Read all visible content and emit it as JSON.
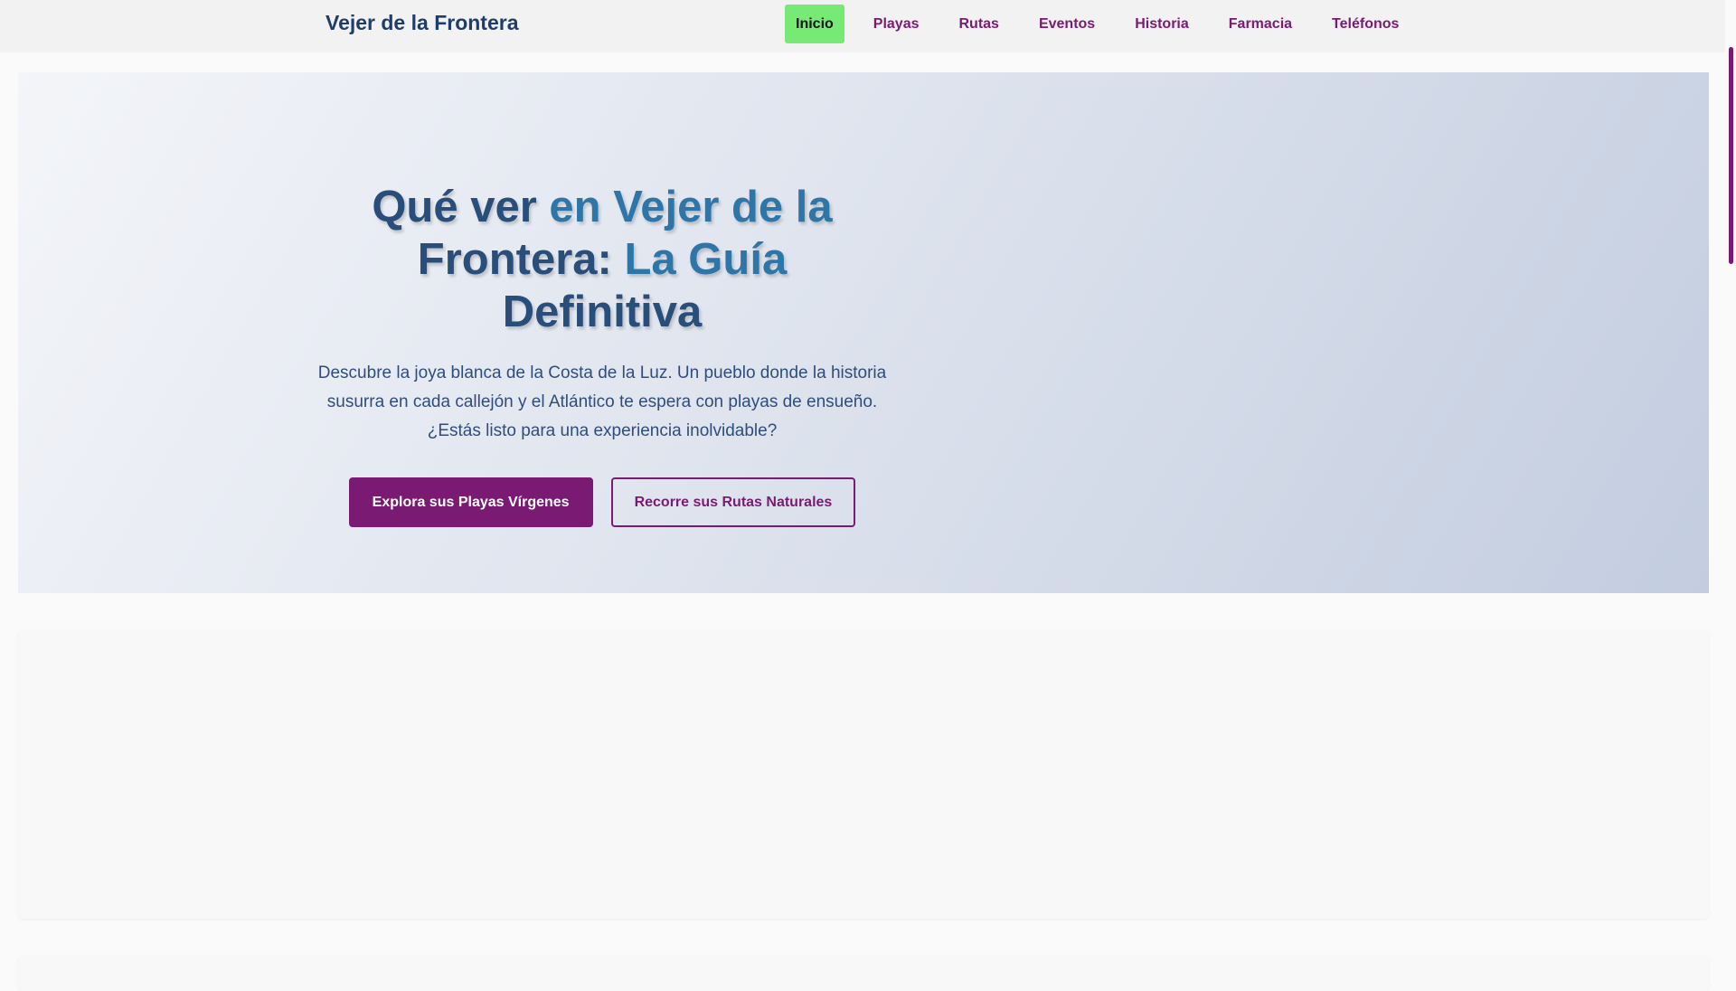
{
  "header": {
    "brand": "Vejer de la Frontera",
    "nav": [
      {
        "label": "Inicio",
        "active": true
      },
      {
        "label": "Playas",
        "active": false
      },
      {
        "label": "Rutas",
        "active": false
      },
      {
        "label": "Eventos",
        "active": false
      },
      {
        "label": "Historia",
        "active": false
      },
      {
        "label": "Farmacia",
        "active": false
      },
      {
        "label": "Teléfonos",
        "active": false
      }
    ]
  },
  "hero": {
    "title_part1": "Qué ver ",
    "title_part2": "en Vejer de la",
    "title_part3": "Frontera: ",
    "title_part4": "La Guía",
    "title_part5": "Definitiva",
    "description": "Descubre la joya blanca de la Costa de la Luz. Un pueblo donde la historia susurra en cada callejón y el Atlántico te espera con playas de ensueño. ¿Estás listo para una experiencia inolvidable?",
    "primary_button": "Explora sus Playas Vírgenes",
    "secondary_button": "Recorre sus Rutas Naturales"
  },
  "colors": {
    "brand_text": "#1f3d6b",
    "nav_link": "#7b1a73",
    "nav_active_bg": "#76ea74",
    "title": "#2a4e7a",
    "title_accent": "#2f76a8",
    "button_primary": "#7b1a73"
  }
}
